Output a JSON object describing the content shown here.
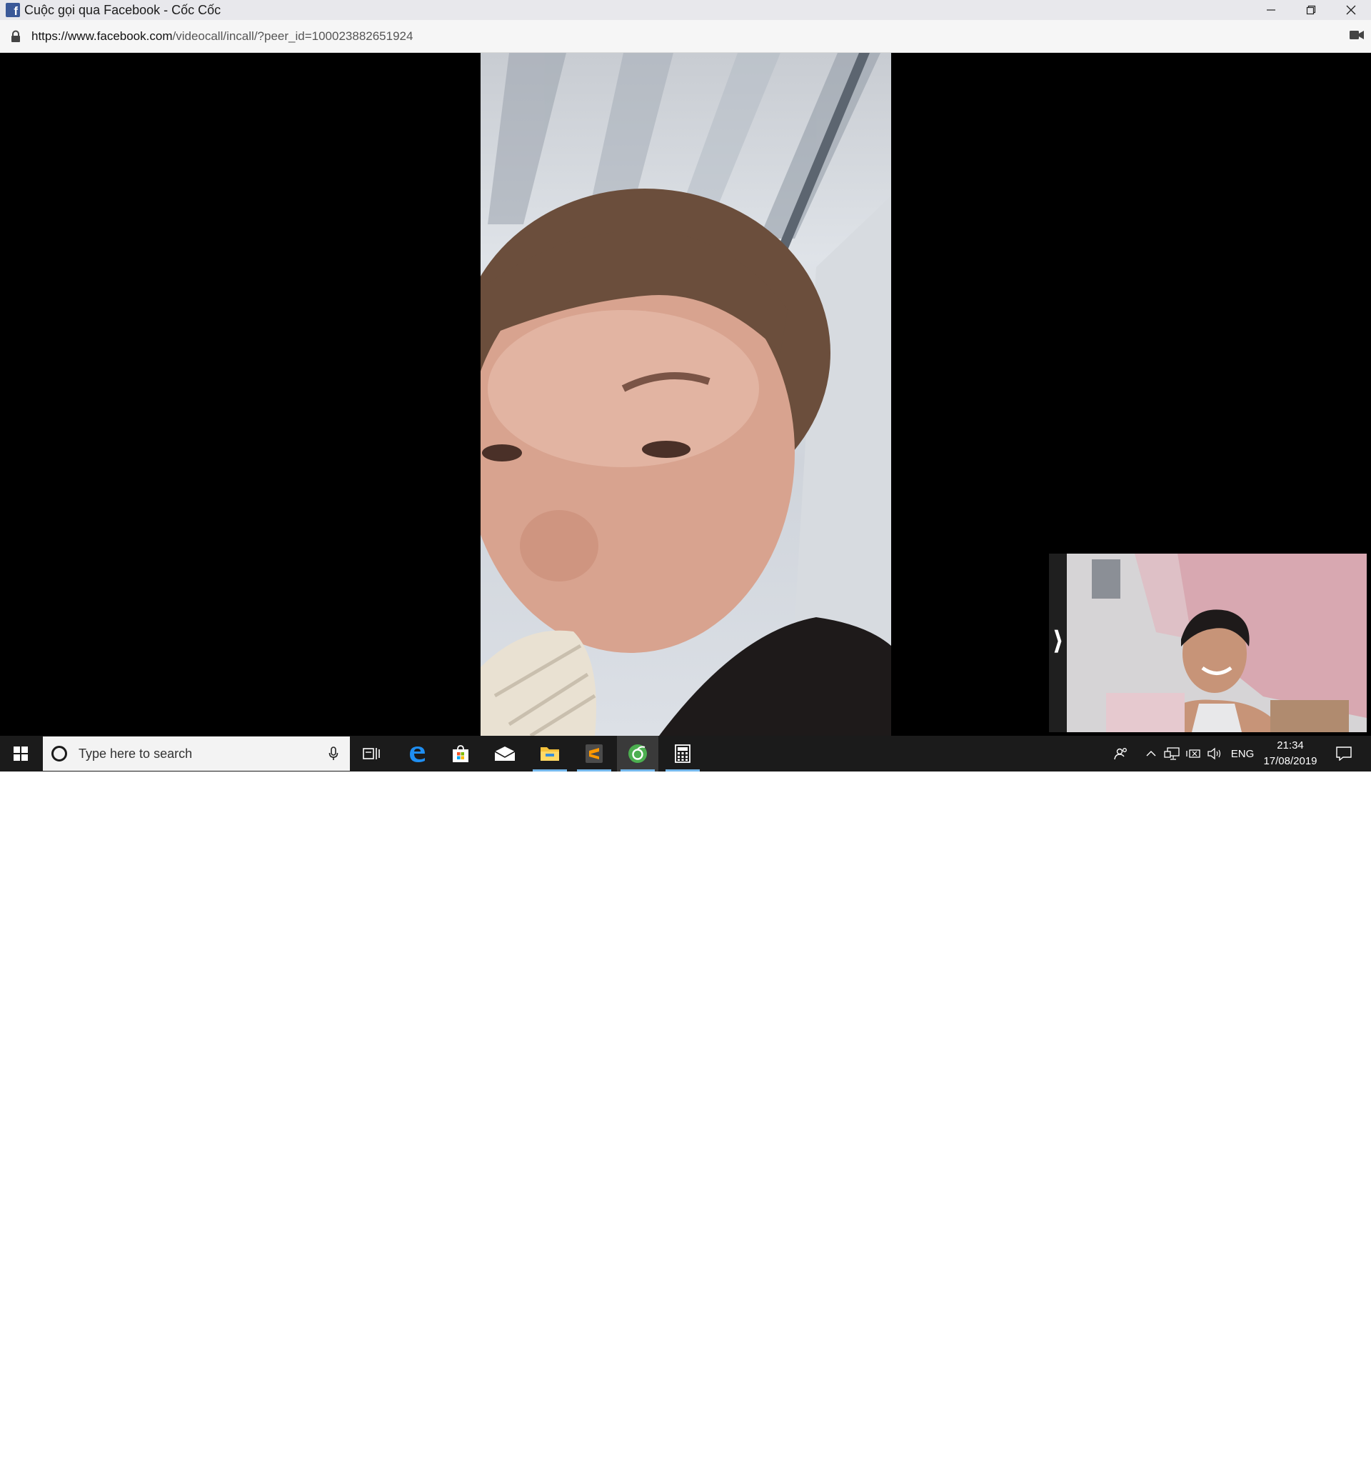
{
  "window": {
    "title": "Cuộc gọi qua Facebook - Cốc Cốc",
    "favicon_letter": "f",
    "brand_color": "#3b5998"
  },
  "address_bar": {
    "url_host": "https://www.facebook.com",
    "url_path": "/videocall/incall/?peer_id=100023882651924"
  },
  "call": {
    "collapse_arrow": "⟩"
  },
  "taskbar": {
    "search_placeholder": "Type here to search",
    "apps": [
      "task-view",
      "edge",
      "store",
      "mail",
      "file-explorer",
      "sublime-text",
      "coc-coc",
      "calculator"
    ],
    "language": "ENG",
    "time": "21:34",
    "date": "17/08/2019",
    "accent": "#76b9ed"
  }
}
